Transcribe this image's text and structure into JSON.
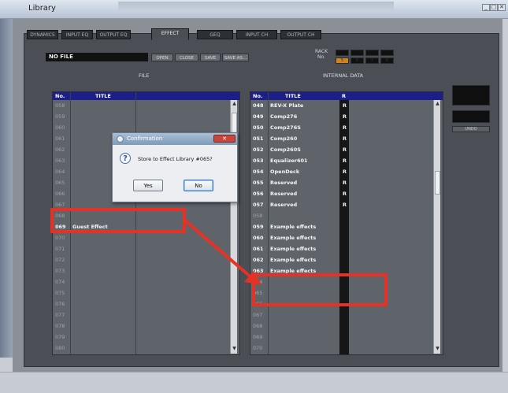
{
  "window": {
    "title": "Library"
  },
  "tabs": [
    "DYNAMICS",
    "INPUT EQ",
    "OUTPUT EQ",
    "EFFECT",
    "GEQ",
    "INPUT CH",
    "OUTPUT CH"
  ],
  "active_tab": "EFFECT",
  "toolbar": {
    "file_name": "NO FILE",
    "open_label": "OPEN",
    "close_label": "CLOSE",
    "save_label": "SAVE",
    "saveas_label": "SAVE AS..."
  },
  "rack": {
    "label": "RACK",
    "no_label": "No.",
    "cells": [
      "5",
      "6",
      "7",
      "8"
    ],
    "selected": "5"
  },
  "file_section": {
    "label": "FILE",
    "headers": {
      "no": "No.",
      "title": "TITLE"
    },
    "rows": [
      {
        "no": "058",
        "title": ""
      },
      {
        "no": "059",
        "title": ""
      },
      {
        "no": "060",
        "title": ""
      },
      {
        "no": "061",
        "title": ""
      },
      {
        "no": "062",
        "title": ""
      },
      {
        "no": "063",
        "title": ""
      },
      {
        "no": "064",
        "title": ""
      },
      {
        "no": "065",
        "title": ""
      },
      {
        "no": "066",
        "title": ""
      },
      {
        "no": "067",
        "title": ""
      },
      {
        "no": "068",
        "title": ""
      },
      {
        "no": "069",
        "title": "Guest Effect"
      },
      {
        "no": "070",
        "title": ""
      },
      {
        "no": "071",
        "title": ""
      },
      {
        "no": "072",
        "title": ""
      },
      {
        "no": "073",
        "title": ""
      },
      {
        "no": "074",
        "title": ""
      },
      {
        "no": "075",
        "title": ""
      },
      {
        "no": "076",
        "title": ""
      },
      {
        "no": "077",
        "title": ""
      },
      {
        "no": "078",
        "title": ""
      },
      {
        "no": "079",
        "title": ""
      },
      {
        "no": "080",
        "title": ""
      }
    ]
  },
  "internal_section": {
    "label": "INTERNAL DATA",
    "headers": {
      "no": "No.",
      "title": "TITLE",
      "r": "R"
    },
    "rows": [
      {
        "no": "048",
        "title": "REV-X Plate",
        "r": "R"
      },
      {
        "no": "049",
        "title": "Comp276",
        "r": "R"
      },
      {
        "no": "050",
        "title": "Comp276S",
        "r": "R"
      },
      {
        "no": "051",
        "title": "Comp260",
        "r": "R"
      },
      {
        "no": "052",
        "title": "Comp260S",
        "r": "R"
      },
      {
        "no": "053",
        "title": "Equalizer601",
        "r": "R"
      },
      {
        "no": "054",
        "title": "OpenDeck",
        "r": "R"
      },
      {
        "no": "055",
        "title": "Reserved",
        "r": "R"
      },
      {
        "no": "056",
        "title": "Reserved",
        "r": "R"
      },
      {
        "no": "057",
        "title": "Reserved",
        "r": "R"
      },
      {
        "no": "058",
        "title": "",
        "r": ""
      },
      {
        "no": "059",
        "title": "Example effects",
        "r": ""
      },
      {
        "no": "060",
        "title": "Example effects",
        "r": ""
      },
      {
        "no": "061",
        "title": "Example effects",
        "r": ""
      },
      {
        "no": "062",
        "title": "Example effects",
        "r": ""
      },
      {
        "no": "063",
        "title": "Example effects",
        "r": ""
      },
      {
        "no": "064",
        "title": "",
        "r": ""
      },
      {
        "no": "065",
        "title": "",
        "r": ""
      },
      {
        "no": "066",
        "title": "",
        "r": ""
      },
      {
        "no": "067",
        "title": "",
        "r": ""
      },
      {
        "no": "068",
        "title": "",
        "r": ""
      },
      {
        "no": "069",
        "title": "",
        "r": ""
      },
      {
        "no": "070",
        "title": "",
        "r": ""
      }
    ]
  },
  "undo_label": "UNDO",
  "dialog": {
    "title": "Confirmation",
    "message": "Store to Effect Library #065?",
    "yes_label": "Yes",
    "no_label": "No",
    "question_glyph": "?",
    "close_glyph": "✕"
  },
  "window_controls": [
    "_",
    "□",
    "✕"
  ],
  "colors": {
    "highlight": "#e53225",
    "list_header": "#1c1e8a",
    "rack_selected": "#d08420"
  }
}
